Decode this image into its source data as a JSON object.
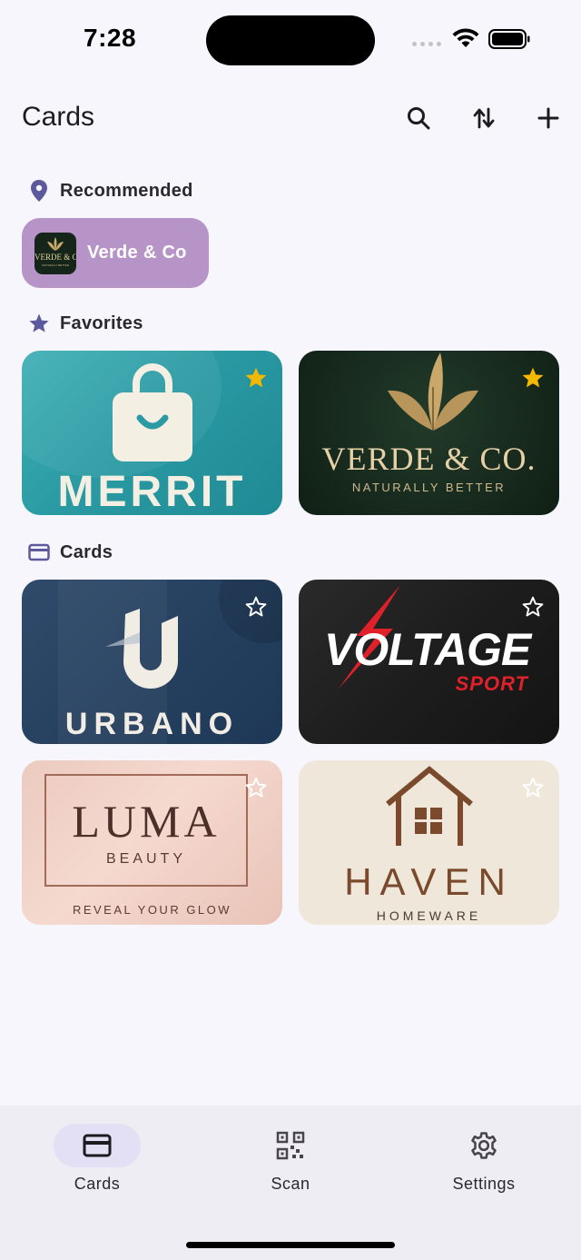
{
  "status_bar": {
    "time": "7:28"
  },
  "app_bar": {
    "title": "Cards"
  },
  "sections": {
    "recommended": "Recommended",
    "favorites": "Favorites",
    "cards": "Cards"
  },
  "recommended_chip": {
    "label": "Verde & Co",
    "logo_text": "VERDE & CO",
    "logo_subtext": "NATURALLY BETTER"
  },
  "favorites": [
    {
      "brand": "MERRIT",
      "starred": true,
      "color": "#2a9aa3"
    },
    {
      "brand": "VERDE & CO.",
      "tagline": "NATURALLY BETTER",
      "starred": true,
      "color": "#15271b"
    }
  ],
  "cards": [
    {
      "brand": "URBANO",
      "starred": false,
      "color": "#25405f"
    },
    {
      "brand": "VOLTAGE",
      "tagline": "SPORT",
      "starred": false,
      "color": "#1d1d1d"
    },
    {
      "brand": "LUMA",
      "subtitle": "BEAUTY",
      "tagline": "REVEAL YOUR GLOW",
      "starred": false,
      "color": "#f5d9cf"
    },
    {
      "brand": "HAVEN",
      "tagline": "HOMEWARE",
      "starred": false,
      "color": "#eee7da"
    }
  ],
  "bottom_nav": {
    "items": [
      {
        "label": "Cards",
        "icon": "card-icon",
        "active": true
      },
      {
        "label": "Scan",
        "icon": "qr-code-icon",
        "active": false
      },
      {
        "label": "Settings",
        "icon": "gear-icon",
        "active": false
      }
    ]
  },
  "colors": {
    "background": "#f8f6fd",
    "accent": "#5c5a9c",
    "favorite_star": "#f5b800",
    "recommended_chip": "#b794c8",
    "nav_active_pill": "#e3dff5"
  }
}
